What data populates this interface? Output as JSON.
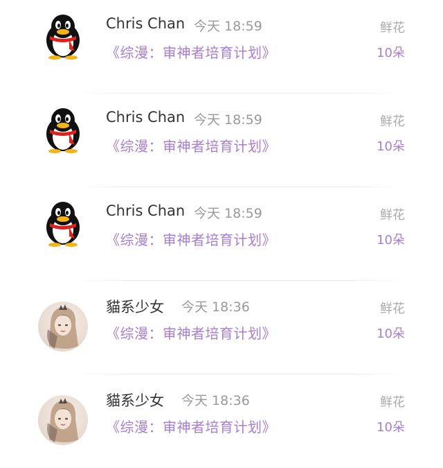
{
  "gifts": [
    {
      "user": "Chris Chan",
      "time": "今天 18:59",
      "book": "《综漫：审神者培育计划》",
      "gift": "鲜花",
      "count": "10朵",
      "avatar_icon": "qq-penguin-icon"
    },
    {
      "user": "Chris Chan",
      "time": "今天 18:59",
      "book": "《综漫：审神者培育计划》",
      "gift": "鲜花",
      "count": "10朵",
      "avatar_icon": "qq-penguin-icon"
    },
    {
      "user": "Chris Chan",
      "time": "今天 18:59",
      "book": "《综漫：审神者培育计划》",
      "gift": "鲜花",
      "count": "10朵",
      "avatar_icon": "qq-penguin-icon"
    },
    {
      "user": "貓系少女",
      "time": "今天 18:36",
      "book": "《综漫：审神者培育计划》",
      "gift": "鲜花",
      "count": "10朵",
      "avatar_icon": "illustrated-girl-avatar"
    },
    {
      "user": "貓系少女",
      "time": "今天 18:36",
      "book": "《综漫：审神者培育计划》",
      "gift": "鲜花",
      "count": "10朵",
      "avatar_icon": "illustrated-girl-avatar"
    }
  ],
  "colors": {
    "accent": "#a77ed4",
    "name": "#333333",
    "muted": "#999999"
  }
}
